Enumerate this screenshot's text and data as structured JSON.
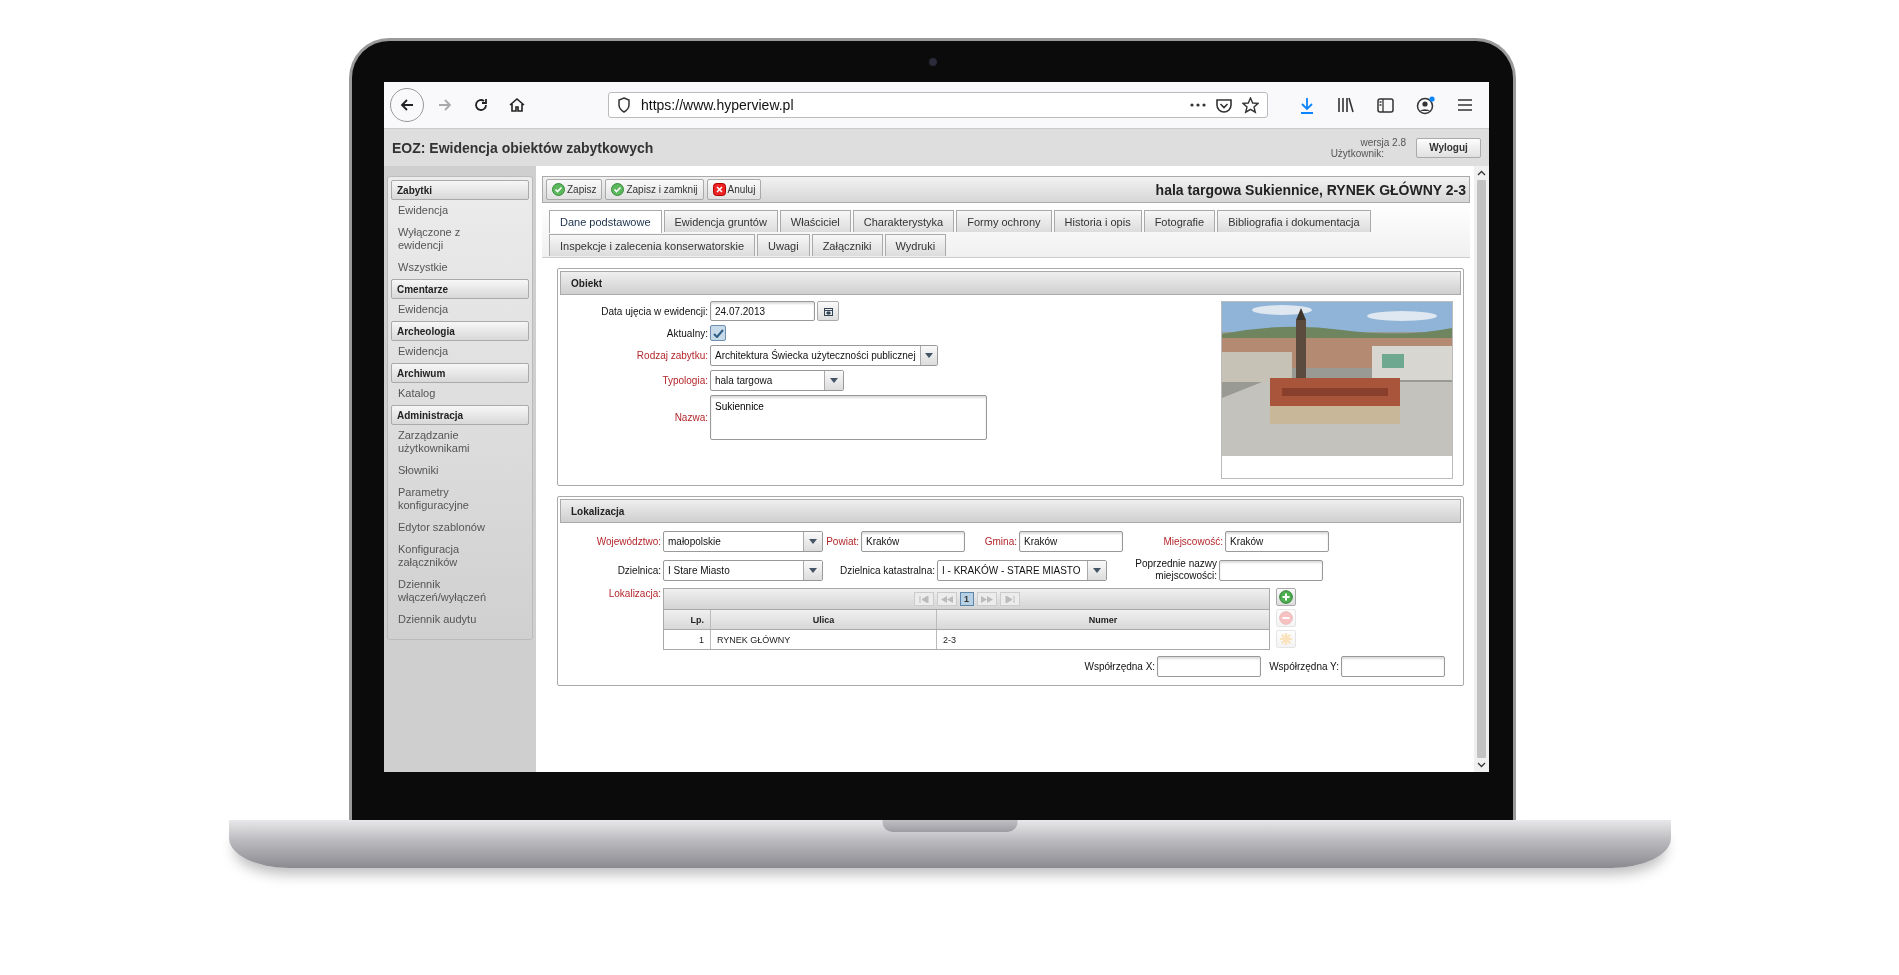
{
  "browser": {
    "url": "https://www.hyperview.pl"
  },
  "app": {
    "title": "EOZ: Ewidencja obiektów zabytkowych",
    "version": "wersja 2.8",
    "user_label": "Użytkownik:",
    "logout": "Wyloguj"
  },
  "sidebar": [
    {
      "title": "Zabytki",
      "items": [
        "Ewidencja",
        "Wyłączone z ewidencji",
        "Wszystkie"
      ]
    },
    {
      "title": "Cmentarze",
      "items": [
        "Ewidencja"
      ]
    },
    {
      "title": "Archeologia",
      "items": [
        "Ewidencja"
      ]
    },
    {
      "title": "Archiwum",
      "items": [
        "Katalog"
      ]
    },
    {
      "title": "Administracja",
      "items": [
        "Zarządzanie użytkownikami",
        "Słowniki",
        "Parametry konfiguracyjne",
        "Edytor szablonów",
        "Konfiguracja załączników",
        "Dziennik włączeń/wyłączeń",
        "Dziennik audytu"
      ]
    }
  ],
  "toolbar": {
    "buttons": [
      {
        "label": "Zapisz",
        "kind": "save"
      },
      {
        "label": "Zapisz i zamknij",
        "kind": "save"
      },
      {
        "label": "Anuluj",
        "kind": "cancel"
      }
    ],
    "record_title": "hala targowa Sukiennice, RYNEK GŁÓWNY 2-3"
  },
  "tab_rows": [
    [
      {
        "label": "Dane podstawowe",
        "selected": true
      },
      {
        "label": "Ewidencja gruntów",
        "selected": false
      },
      {
        "label": "Właściciel",
        "selected": false
      },
      {
        "label": "Charakterystyka",
        "selected": false
      },
      {
        "label": "Formy ochrony",
        "selected": false
      },
      {
        "label": "Historia i opis",
        "selected": false
      },
      {
        "label": "Fotografie",
        "selected": false
      },
      {
        "label": "Bibliografia i dokumentacja",
        "selected": false
      }
    ],
    [
      {
        "label": "Inspekcje i zalecenia konserwatorskie",
        "selected": false
      },
      {
        "label": "Uwagi",
        "selected": false
      },
      {
        "label": "Załączniki",
        "selected": false
      },
      {
        "label": "Wydruki",
        "selected": false
      }
    ]
  ],
  "obiekt": {
    "title": "Obiekt",
    "fields": [
      {
        "kind": "date",
        "label": "Data ujęcia w ewidencji:",
        "value": "24.07.2013",
        "required": false
      },
      {
        "kind": "checkbox",
        "label": "Aktualny:",
        "checked": true,
        "required": false
      },
      {
        "kind": "select",
        "label": "Rodzaj zabytku:",
        "value": "Architektura Świecka użyteczności publicznej",
        "required": true
      },
      {
        "kind": "select",
        "label": "Typologia:",
        "value": "hala targowa",
        "required": true
      },
      {
        "kind": "textarea",
        "label": "Nazwa:",
        "value": "Sukiennice",
        "required": true
      }
    ]
  },
  "lokalizacja": {
    "title": "Lokalizacja",
    "fields": [
      {
        "kind": "select",
        "label": "Województwo:",
        "value": "małopolskie",
        "required": true
      },
      {
        "kind": "text",
        "label": "Powiat:",
        "value": "Kraków",
        "required": true
      },
      {
        "kind": "text",
        "label": "Gmina:",
        "value": "Kraków",
        "required": true
      },
      {
        "kind": "text",
        "label": "Miejscowość:",
        "value": "Kraków",
        "required": true
      },
      {
        "kind": "select",
        "label": "Dzielnica:",
        "value": "I Stare Miasto",
        "required": false
      },
      {
        "kind": "select",
        "label": "Dzielnica katastralna:",
        "value": "I - KRAKÓW - STARE MIASTO",
        "required": false
      },
      {
        "kind": "text",
        "label": "Poprzednie nazwy miejscowości:",
        "required": false
      }
    ],
    "grid": {
      "label": "Lokalizacja:",
      "required": true,
      "pages": [
        {
          "label": "1",
          "selected": true
        }
      ],
      "columns": [
        "Lp.",
        "Ulica",
        "Numer"
      ],
      "rows": [
        [
          "1",
          "RYNEK GŁÓWNY",
          "2-3"
        ]
      ],
      "actions": [
        {
          "kind": "add",
          "disabled": false
        },
        {
          "kind": "remove",
          "disabled": true
        },
        {
          "kind": "edit",
          "disabled": true
        }
      ]
    },
    "coords": [
      {
        "label": "Współrzędna X:"
      },
      {
        "label": "Współrzędna Y:"
      }
    ]
  }
}
